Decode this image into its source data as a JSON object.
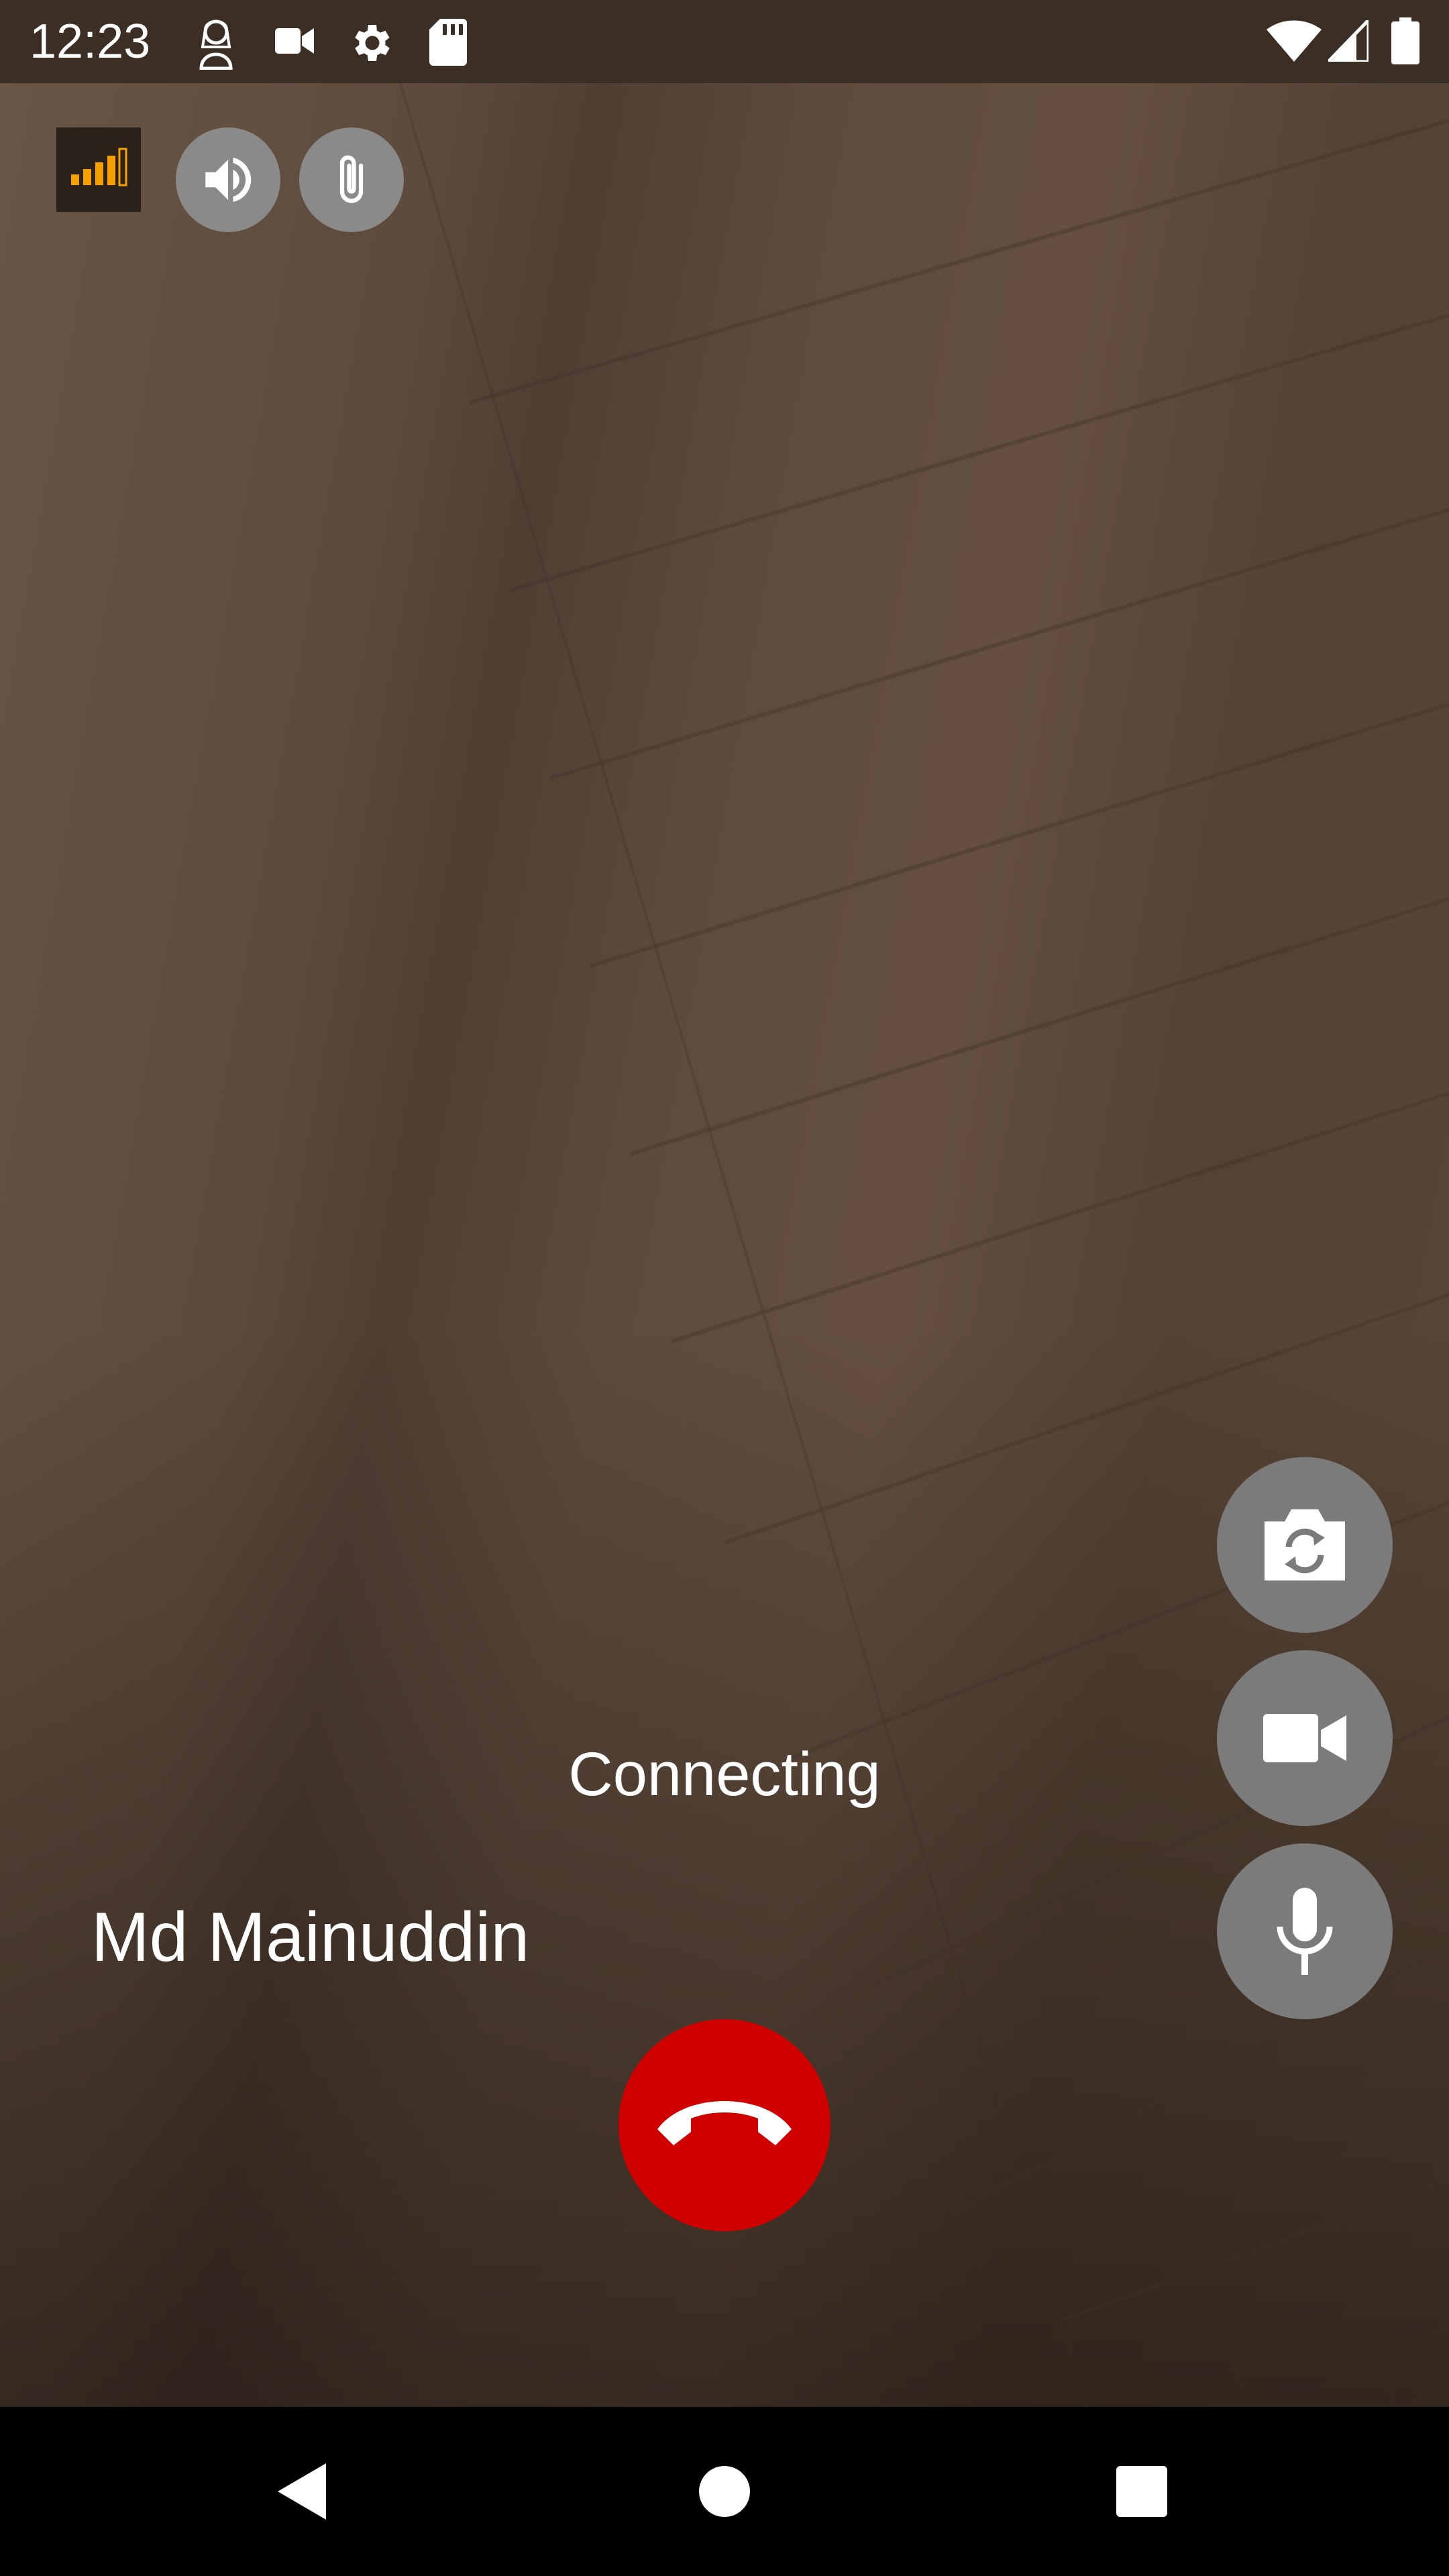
{
  "status_bar": {
    "time": "12:23",
    "icons": [
      "avatar-notification-icon",
      "video-notification-icon",
      "gear-icon",
      "sd-card-icon",
      "wifi-icon",
      "cell-signal-icon",
      "battery-icon"
    ]
  },
  "top_controls": {
    "signal_quality_icon": "signal-bars-icon",
    "speaker_icon": "speaker-icon",
    "attach_icon": "paperclip-icon"
  },
  "call": {
    "status": "Connecting",
    "caller_name": "Md Mainuddin"
  },
  "side_controls": [
    "switch-camera-icon",
    "video-camera-icon",
    "microphone-icon"
  ],
  "colors": {
    "end_call": "#d10000",
    "control_button": "#7b7b7b",
    "signal_bars": "#f5a000",
    "status_bar": "#3b2e25",
    "nav_bar": "#000000"
  },
  "nav_bar": [
    "back-icon",
    "home-icon",
    "recents-icon"
  ]
}
